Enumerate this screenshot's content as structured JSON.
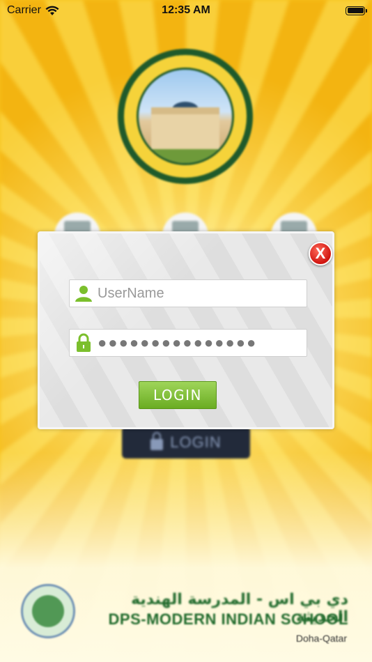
{
  "status_bar": {
    "carrier": "Carrier",
    "time": "12:35 AM"
  },
  "background": {
    "login_label": "LOGIN",
    "school_name_arabic": "دي بي اس - المدرسة الهندية الحديثة",
    "school_name": "DPS-MODERN INDIAN SCHOOL",
    "location": "Doha-Qatar"
  },
  "login_dialog": {
    "close_label": "X",
    "username": {
      "placeholder": "UserName",
      "value": ""
    },
    "password": {
      "masked_value": "●●●●●●●●●●●●●●●"
    },
    "login_label": "LOGIN"
  },
  "colors": {
    "accent_green": "#7bbf2c",
    "close_red": "#d0140f",
    "sunburst_yellow": "#f7c21c"
  }
}
